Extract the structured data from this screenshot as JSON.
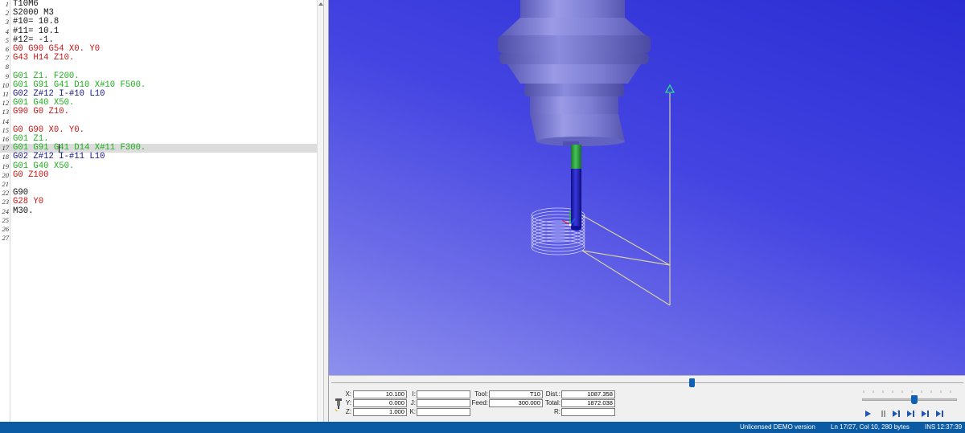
{
  "editor": {
    "current_line_index": 16,
    "lines": [
      {
        "n": "1",
        "text": "T10M6",
        "color": "#101010"
      },
      {
        "n": "2",
        "text": "S2000 M3",
        "color": "#101010"
      },
      {
        "n": "3",
        "text": "#10= 10.8",
        "color": "#101010"
      },
      {
        "n": "4",
        "text": "#11= 10.1",
        "color": "#101010"
      },
      {
        "n": "5",
        "text": "#12= -1.",
        "color": "#101010"
      },
      {
        "n": "6",
        "text": "G0 G90 G54 X0. Y0",
        "color": "#c81414"
      },
      {
        "n": "7",
        "text": "G43 H14 Z10.",
        "color": "#c81414"
      },
      {
        "n": "8",
        "text": "",
        "color": "#101010"
      },
      {
        "n": "9",
        "text": "G01 Z1. F200.",
        "color": "#1eae1e"
      },
      {
        "n": "10",
        "text": "G01 G91 G41 D10 X#10 F500.",
        "color": "#1eae1e"
      },
      {
        "n": "11",
        "text": "G02 Z#12 I-#10 L10",
        "color": "#16168c"
      },
      {
        "n": "12",
        "text": "G01 G40 X50.",
        "color": "#1eae1e"
      },
      {
        "n": "13",
        "text": "G90 G0 Z10.",
        "color": "#c81414"
      },
      {
        "n": "14",
        "text": "",
        "color": "#101010"
      },
      {
        "n": "15",
        "text": "G0 G90 X0. Y0.",
        "color": "#c81414"
      },
      {
        "n": "16",
        "text": "G01 Z1.",
        "color": "#1eae1e"
      },
      {
        "n": "17",
        "text": "G01 G91 G41 D14 X#11 F300.",
        "color": "#1eae1e"
      },
      {
        "n": "18",
        "text": "G02 Z#12 I-#11 L10",
        "color": "#16168c"
      },
      {
        "n": "19",
        "text": "G01 G40 X50.",
        "color": "#1eae1e"
      },
      {
        "n": "20",
        "text": "G0 Z100",
        "color": "#c81414"
      },
      {
        "n": "21",
        "text": "",
        "color": "#101010"
      },
      {
        "n": "22",
        "text": "G90",
        "color": "#101010"
      },
      {
        "n": "23",
        "text": "G28 Y0",
        "color": "#c81414"
      },
      {
        "n": "24",
        "text": "M30.",
        "color": "#101010"
      },
      {
        "n": "25",
        "text": "",
        "color": "#101010"
      },
      {
        "n": "26",
        "text": "",
        "color": "#101010"
      },
      {
        "n": "27",
        "text": "",
        "color": "#101010"
      }
    ]
  },
  "readouts": {
    "x_label": "X:",
    "x_value": "10.100",
    "y_label": "Y:",
    "y_value": "0.000",
    "z_label": "Z:",
    "z_value": "1.000",
    "i_label": "I:",
    "i_value": "",
    "j_label": "J:",
    "j_value": "",
    "k_label": "K:",
    "k_value": "",
    "tool_label": "Tool:",
    "tool_value": "T10",
    "feed_label": "Feed:",
    "feed_value": "300.000",
    "dist_label": "Dist.:",
    "dist_value": "1087.358",
    "total_label": "Total:",
    "total_value": "1872.038",
    "r_label": "R:",
    "r_value": ""
  },
  "simulation": {
    "timeline_progress": 0.57,
    "speed_level": 0.55
  },
  "status": {
    "license": "Unlicensed DEMO version",
    "position": "Ln 17/27, Col 10, 280 bytes",
    "mode": "INS",
    "time": "12:37:39"
  },
  "icons": [
    "tool-icon",
    "play-icon",
    "step-icon",
    "step-into-icon",
    "step-over-icon",
    "step-z-icon",
    "step-xyz-icon"
  ],
  "colors": {
    "viewport_top": "#2a2dd2",
    "viewport_bottom": "#8e90ec",
    "spindle": "#8282d6",
    "status_bar": "#0b5ba4",
    "slider_thumb": "#1060b8"
  }
}
